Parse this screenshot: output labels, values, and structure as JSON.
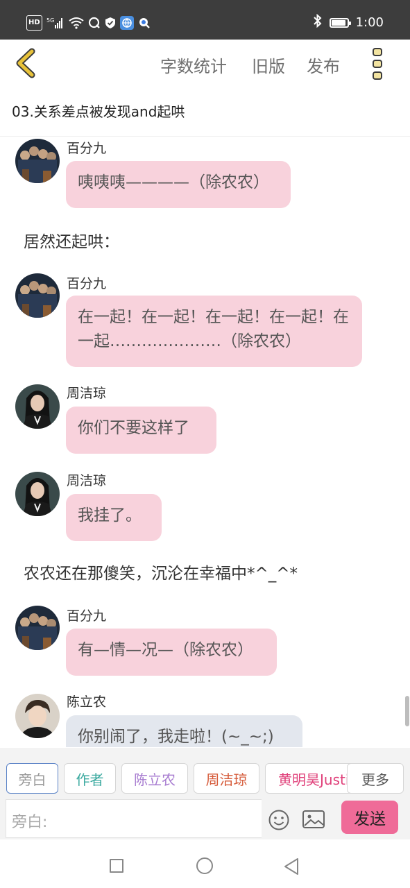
{
  "status_bar": {
    "network_label": "HD",
    "signal_label": "5G",
    "time": "1:00",
    "battery_percent": 90
  },
  "toolbar": {
    "word_count": "字数统计",
    "old_version": "旧版",
    "publish": "发布"
  },
  "chapter_title": "03.关系差点被发现and起哄",
  "messages": [
    {
      "type": "chat",
      "name": "百分九",
      "text": "咦咦咦————（除农农）",
      "color": "pink",
      "avatar": "group"
    },
    {
      "type": "narration",
      "text": "居然还起哄："
    },
    {
      "type": "chat",
      "name": "百分九",
      "text": "在一起！在一起！在一起！在一起！在一起…………………（除农农）",
      "color": "pink",
      "avatar": "group"
    },
    {
      "type": "chat",
      "name": "周洁琼",
      "text": "你们不要这样了",
      "color": "pink",
      "avatar": "girl"
    },
    {
      "type": "chat",
      "name": "周洁琼",
      "text": "我挂了。",
      "color": "pink",
      "avatar": "girl"
    },
    {
      "type": "narration",
      "text": "农农还在那傻笑，沉沦在幸福中*^_^*"
    },
    {
      "type": "chat",
      "name": "百分九",
      "text": "有—情—况—（除农农）",
      "color": "pink",
      "avatar": "group"
    },
    {
      "type": "chat",
      "name": "陈立农",
      "text": "你别闹了，我走啦！(~_~;)",
      "color": "grey",
      "avatar": "boy"
    }
  ],
  "role_chips": [
    {
      "label": "旁白",
      "color": "#9a9a9a",
      "active": true
    },
    {
      "label": "作者",
      "color": "#3aa99f",
      "active": false
    },
    {
      "label": "陈立农",
      "color": "#a77bd0",
      "active": false
    },
    {
      "label": "周洁琼",
      "color": "#d65b3a",
      "active": false
    },
    {
      "label": "黄明昊Justin",
      "color": "#e0407a",
      "active": false
    }
  ],
  "more_roles": "更多",
  "input": {
    "placeholder": "旁白:"
  },
  "send_button": "发送",
  "colors": {
    "bubble_pink": "#f8d2dc",
    "bubble_grey": "#e3e7ee",
    "send_button": "#ef6b98",
    "back_arrow": "#e8c23a"
  }
}
